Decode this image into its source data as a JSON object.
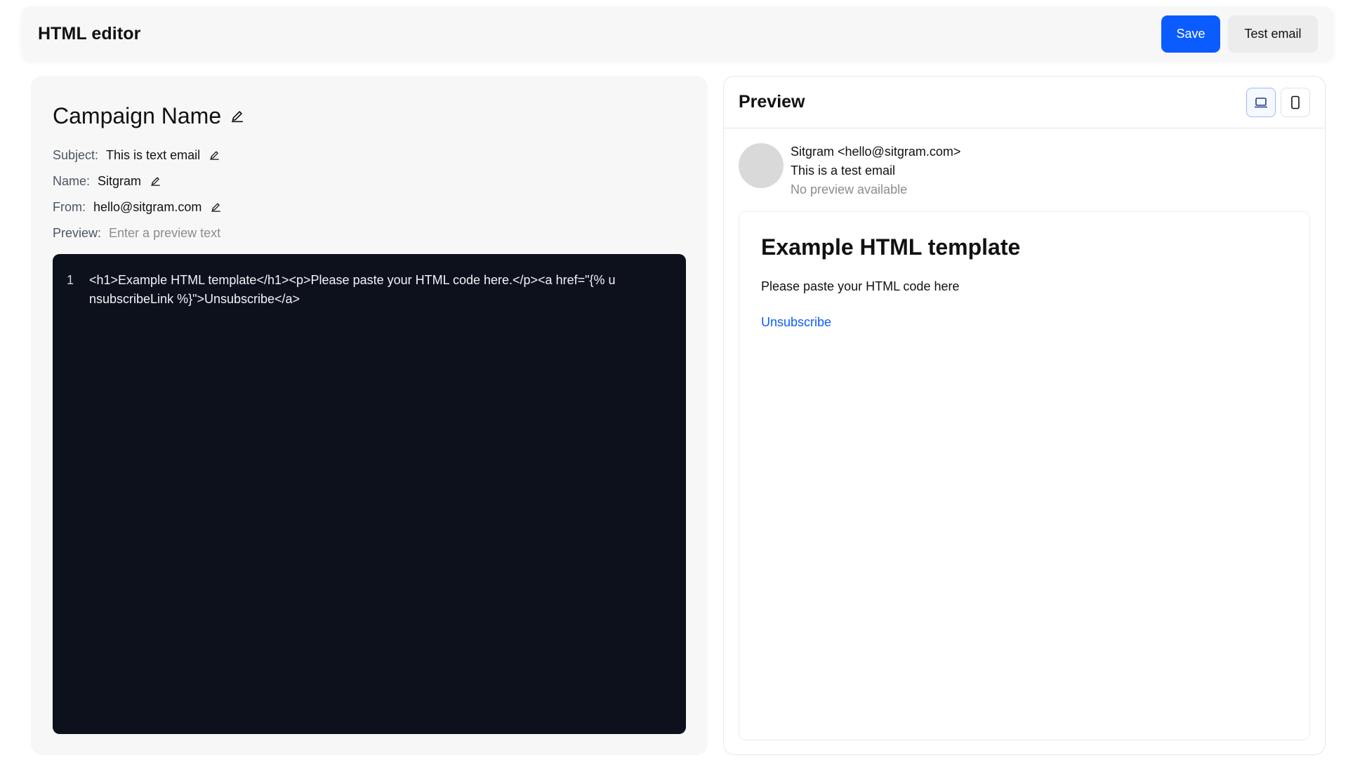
{
  "header": {
    "title": "HTML editor",
    "save_label": "Save",
    "test_email_label": "Test email"
  },
  "campaign": {
    "name": "Campaign Name",
    "fields": {
      "subject_label": "Subject:",
      "subject_value": "This is text email",
      "name_label": "Name:",
      "name_value": "Sitgram",
      "from_label": "From:",
      "from_value": "hello@sitgram.com",
      "preview_label": "Preview:",
      "preview_placeholder": "Enter a preview text"
    }
  },
  "editor": {
    "line_number": "1",
    "code": "<h1>Example HTML template</h1><p>Please paste your HTML code here.</p><a href=\"{% unsubscribeLink %}\">Unsubscribe</a>"
  },
  "preview": {
    "title": "Preview",
    "active_device": "desktop",
    "sender": {
      "from": "Sitgram <hello@sitgram.com>",
      "subject": "This is a test email",
      "preview_text": "No preview available"
    },
    "email": {
      "heading": "Example HTML template",
      "paragraph": "Please paste your HTML code here",
      "link_text": "Unsubscribe"
    }
  },
  "colors": {
    "primary": "#0b5cff",
    "editor_bg": "#0d111c",
    "panel_bg": "#f7f7f7"
  }
}
